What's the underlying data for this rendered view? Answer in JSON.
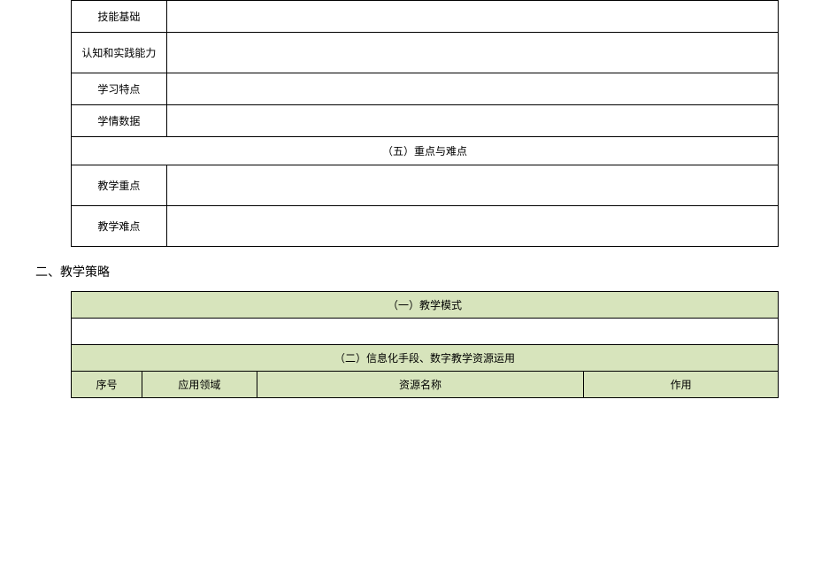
{
  "table1": {
    "rows": {
      "skill_base": "技能基础",
      "cognition": "认知和实践能力",
      "learning": "学习特点",
      "data": "学情数据"
    },
    "section5": "（五）重点与难点",
    "focus_rows": {
      "key_point": "教学重点",
      "difficulty": "教学难点"
    }
  },
  "section2_title": "二、教学策略",
  "table2": {
    "header1": "（一）教学模式",
    "header2": "（二）信息化手段、数字教学资源运用",
    "cols": {
      "seq": "序号",
      "field": "应用领域",
      "name": "资源名称",
      "func": "作用"
    }
  }
}
